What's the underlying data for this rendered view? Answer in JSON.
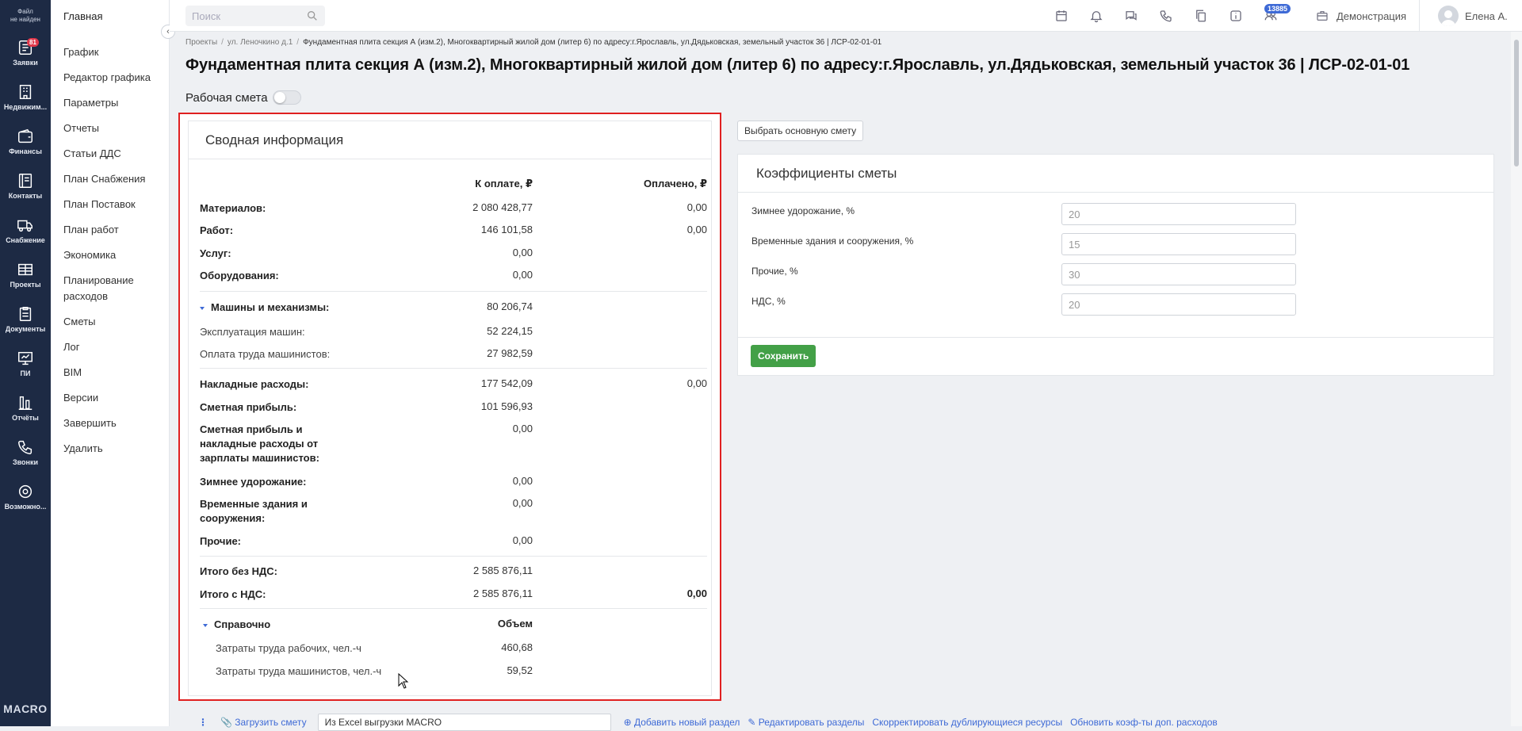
{
  "rail": {
    "file_line1": "Файл",
    "file_line2": "не найден",
    "items": [
      {
        "label": "Заявки",
        "icon": "requests-icon",
        "badge": "81"
      },
      {
        "label": "Недвижим...",
        "icon": "building-icon"
      },
      {
        "label": "Финансы",
        "icon": "wallet-icon"
      },
      {
        "label": "Контакты",
        "icon": "contacts-icon"
      },
      {
        "label": "Снабжение",
        "icon": "truck-icon"
      },
      {
        "label": "Проекты",
        "icon": "projects-icon"
      },
      {
        "label": "Документы",
        "icon": "documents-icon"
      },
      {
        "label": "ПИ",
        "icon": "monitor-icon"
      },
      {
        "label": "Отчёты",
        "icon": "reports-icon"
      },
      {
        "label": "Звонки",
        "icon": "phone-icon"
      },
      {
        "label": "Возможно...",
        "icon": "settings-icon"
      }
    ],
    "brand": "MACRO"
  },
  "nav": {
    "head": "Главная",
    "items": [
      "График",
      "Редактор графика",
      "Параметры",
      "Отчеты",
      "Статьи ДДС",
      "План Снабжения",
      "План Поставок",
      "План работ",
      "Экономика",
      "Планирование расходов",
      "Сметы",
      "Лог",
      "BIM",
      "Версии",
      "Завершить",
      "Удалить"
    ]
  },
  "topbar": {
    "search_placeholder": "Поиск",
    "notif_count": "13885",
    "demo": "Демонстрация",
    "user": "Елена А."
  },
  "breadcrumb": {
    "projects": "Проекты",
    "street": "ул. Леночкино д.1",
    "current": "Фундаментная плита секция А (изм.2), Многоквартирный жилой дом (литер 6) по адресу:г.Ярославль, ул.Дядьковская, земельный участок 36 | ЛСР-02-01-01"
  },
  "title": "Фундаментная плита секция А (изм.2), Многоквартирный жилой дом (литер 6) по адресу:г.Ярославль, ул.Дядьковская, земельный участок 36 | ЛСР-02-01-01",
  "work_estimate_label": "Рабочая смета",
  "summary": {
    "title": "Сводная информация",
    "col_to_pay": "К оплате, ₽",
    "col_paid": "Оплачено, ₽",
    "materials": {
      "label": "Материалов:",
      "to_pay": "2 080 428,77",
      "paid": "0,00"
    },
    "works": {
      "label": "Работ:",
      "to_pay": "146 101,58",
      "paid": "0,00"
    },
    "services": {
      "label": "Услуг:",
      "to_pay": "0,00"
    },
    "equipment": {
      "label": "Оборудования:",
      "to_pay": "0,00"
    },
    "machines": {
      "label": "Машины и механизмы:",
      "to_pay": "80 206,74"
    },
    "machine_ops": {
      "label": "Эксплуатация машин:",
      "to_pay": "52 224,15"
    },
    "machinist_pay": {
      "label": "Оплата труда машинистов:",
      "to_pay": "27 982,59"
    },
    "overhead": {
      "label": "Накладные расходы:",
      "to_pay": "177 542,09",
      "paid": "0,00"
    },
    "profit": {
      "label": "Сметная прибыль:",
      "to_pay": "101 596,93"
    },
    "profit_overhead": {
      "label": "Сметная прибыль и накладные расходы от зарплаты машинистов:",
      "to_pay": "0,00"
    },
    "winter": {
      "label": "Зимнее удорожание:",
      "to_pay": "0,00"
    },
    "temp_buildings": {
      "label": "Временные здания и сооружения:",
      "to_pay": "0,00"
    },
    "other": {
      "label": "Прочие:",
      "to_pay": "0,00"
    },
    "total_no_vat": {
      "label": "Итого без НДС:",
      "to_pay": "2 585 876,11"
    },
    "total_vat": {
      "label": "Итого с НДС:",
      "to_pay": "2 585 876,11",
      "paid": "0,00"
    },
    "reference": {
      "label": "Справочно",
      "col": "Объем"
    },
    "labor_workers": {
      "label": "Затраты труда рабочих, чел.-ч",
      "value": "460,68"
    },
    "labor_machinists": {
      "label": "Затраты труда машинистов, чел.-ч",
      "value": "59,52"
    }
  },
  "pick_main_button": "Выбрать основную смету",
  "coefficients": {
    "title": "Коэффициенты сметы",
    "fields": [
      {
        "label": "Зимнее удорожание, %",
        "value": "20"
      },
      {
        "label": "Временные здания и сооружения, %",
        "value": "15"
      },
      {
        "label": "Прочие, %",
        "value": "30"
      },
      {
        "label": "НДС, %",
        "value": "20"
      }
    ],
    "save": "Сохранить"
  },
  "bottom": {
    "upload": "Загрузить смету",
    "source": "Из Excel выгрузки MACRO",
    "add_section": "Добавить новый раздел",
    "edit_sections": "Редактировать разделы",
    "fix_duplicates": "Скорректировать дублирующиеся ресурсы",
    "update_coef": "Обновить коэф-ты доп. расходов"
  },
  "colors": {
    "rail": "#1d2a44",
    "accent": "#3e6ad6",
    "save": "#43a047",
    "highlight": "#e02020"
  }
}
